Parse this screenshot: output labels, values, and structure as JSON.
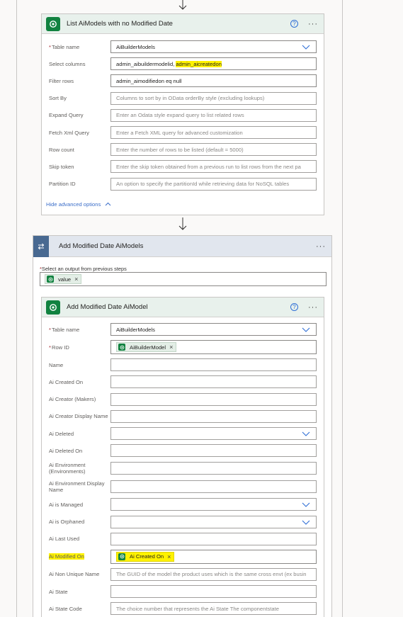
{
  "list_action": {
    "title": "List AiModels with no Modified Date",
    "fields": [
      {
        "label": "Table name",
        "required": true,
        "value": "AiBuilderModels",
        "placeholder": "",
        "dropdown": true
      },
      {
        "label": "Select columns",
        "required": false,
        "value": "admin_aibuildermodelid, ",
        "highlight": "admin_aicreatedon",
        "placeholder": ""
      },
      {
        "label": "Filter rows",
        "required": false,
        "value": "admin_aimodifiedon eq null",
        "placeholder": ""
      },
      {
        "label": "Sort By",
        "required": false,
        "value": "",
        "placeholder": "Columns to sort by in OData orderBy style (excluding lookups)"
      },
      {
        "label": "Expand Query",
        "required": false,
        "value": "",
        "placeholder": "Enter an Odata style expand query to list related rows"
      },
      {
        "label": "Fetch Xml Query",
        "required": false,
        "value": "",
        "placeholder": "Enter a Fetch XML query for advanced customization"
      },
      {
        "label": "Row count",
        "required": false,
        "value": "",
        "placeholder": "Enter the number of rows to be listed (default = 5000)"
      },
      {
        "label": "Skip token",
        "required": false,
        "value": "",
        "placeholder": "Enter the skip token obtained from a previous run to list rows from the next pa"
      },
      {
        "label": "Partition ID",
        "required": false,
        "value": "",
        "placeholder": "An option to specify the partitionId while retrieving data for NoSQL tables"
      }
    ],
    "advanced_link": "Hide advanced options"
  },
  "apply_each": {
    "title": "Add Modified Date AiModels",
    "select_label": "Select an output from previous steps",
    "token": "value"
  },
  "add_action": {
    "title": "Add Modified Date AiModel",
    "table_name_label": "Table name",
    "table_name_value": "AiBuilderModels",
    "row_id_label": "Row ID",
    "row_id_token": "AiBuilderModel",
    "fields": [
      {
        "label": "Name",
        "placeholder": "",
        "dropdown": false
      },
      {
        "label": "Ai Created On",
        "placeholder": "",
        "dropdown": false
      },
      {
        "label": "Ai Creator (Makers)",
        "placeholder": "",
        "dropdown": false
      },
      {
        "label": "Ai Creator Display Name",
        "placeholder": "",
        "dropdown": false
      },
      {
        "label": "Ai Deleted",
        "placeholder": "",
        "dropdown": true
      },
      {
        "label": "Ai Deleted On",
        "placeholder": "",
        "dropdown": false
      },
      {
        "label": "Ai Environment (Environments)",
        "placeholder": "",
        "dropdown": false
      },
      {
        "label": "Ai Environment Display Name",
        "placeholder": "",
        "dropdown": false
      },
      {
        "label": "Ai is Managed",
        "placeholder": "",
        "dropdown": true
      },
      {
        "label": "Ai is Orphaned",
        "placeholder": "",
        "dropdown": true
      },
      {
        "label": "Ai Last Used",
        "placeholder": "",
        "dropdown": false
      }
    ],
    "modified_on_label": "Ai Modified On",
    "modified_on_token": "Ai Created On",
    "tail_fields": [
      {
        "label": "Ai Non Unique Name",
        "placeholder": "The GUID of the model the product uses which is the same cross envt (ex busin"
      },
      {
        "label": "Ai State",
        "placeholder": ""
      },
      {
        "label": "Ai State Code",
        "placeholder": "The choice number that represents the Ai State The componentstate"
      }
    ]
  },
  "colors": {
    "dataverse_green": "#118240",
    "loop_blue": "#486991",
    "highlight": "#fff200",
    "link": "#3b6ec9"
  }
}
